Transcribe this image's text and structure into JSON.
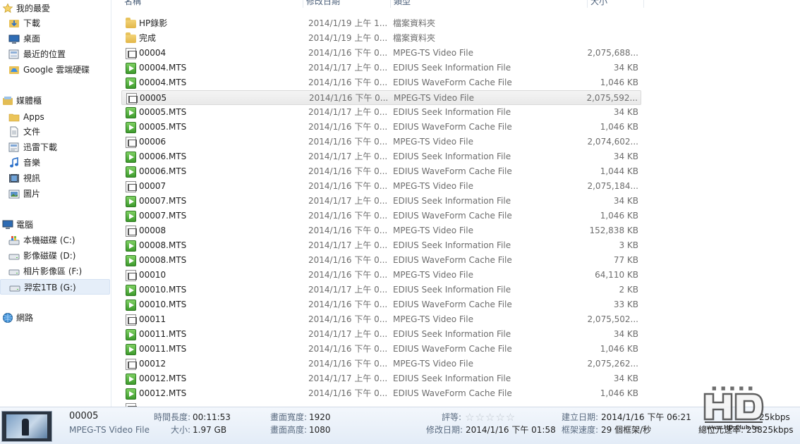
{
  "nav": {
    "favorites": {
      "label": "我的最愛",
      "icon": "star-icon"
    },
    "favorite_items": [
      {
        "label": "下載",
        "icon": "downloads-folder-icon"
      },
      {
        "label": "桌面",
        "icon": "desktop-icon"
      },
      {
        "label": "最近的位置",
        "icon": "recent-places-icon"
      },
      {
        "label": "Google 雲端硬碟",
        "icon": "google-drive-icon"
      }
    ],
    "libraries": {
      "label": "媒體櫃",
      "icon": "library-icon"
    },
    "library_items": [
      {
        "label": "Apps",
        "icon": "folder-icon"
      },
      {
        "label": "文件",
        "icon": "documents-icon"
      },
      {
        "label": "迅雷下載",
        "icon": "thunder-download-icon"
      },
      {
        "label": "音樂",
        "icon": "music-icon"
      },
      {
        "label": "視訊",
        "icon": "video-icon"
      },
      {
        "label": "圖片",
        "icon": "pictures-icon"
      }
    ],
    "computer": {
      "label": "電腦",
      "icon": "computer-icon"
    },
    "drives": [
      {
        "label": "本機磁碟 (C:)",
        "icon": "windows-drive-icon"
      },
      {
        "label": "影像磁碟 (D:)",
        "icon": "drive-icon"
      },
      {
        "label": "相片影像區 (F:)",
        "icon": "drive-icon"
      },
      {
        "label": "羿宏1TB (G:)",
        "icon": "drive-icon"
      }
    ],
    "network": {
      "label": "網路",
      "icon": "network-icon"
    }
  },
  "columns": {
    "name": "名稱",
    "date": "修改日期",
    "type": "類型",
    "size": "大小"
  },
  "files": [
    {
      "name": "HP錄影",
      "date": "2014/1/19 上午 1...",
      "type": "檔案資料夾",
      "size": "",
      "icon": "folder-icon"
    },
    {
      "name": "完成",
      "date": "2014/1/19 上午 0...",
      "type": "檔案資料夾",
      "size": "",
      "icon": "folder-icon"
    },
    {
      "name": "00004",
      "date": "2014/1/16 下午 0...",
      "type": "MPEG-TS Video File",
      "size": "2,075,688...",
      "icon": "video-file-icon"
    },
    {
      "name": "00004.MTS",
      "date": "2014/1/17 上午 0...",
      "type": "EDIUS Seek Information File",
      "size": "34 KB",
      "icon": "edius-file-icon"
    },
    {
      "name": "00004.MTS",
      "date": "2014/1/16 下午 0...",
      "type": "EDIUS WaveForm Cache File",
      "size": "1,046 KB",
      "icon": "edius-file-icon"
    },
    {
      "name": "00005",
      "date": "2014/1/16 下午 0...",
      "type": "MPEG-TS Video File",
      "size": "2,075,592...",
      "icon": "video-file-icon"
    },
    {
      "name": "00005.MTS",
      "date": "2014/1/17 上午 0...",
      "type": "EDIUS Seek Information File",
      "size": "34 KB",
      "icon": "edius-file-icon"
    },
    {
      "name": "00005.MTS",
      "date": "2014/1/16 下午 0...",
      "type": "EDIUS WaveForm Cache File",
      "size": "1,046 KB",
      "icon": "edius-file-icon"
    },
    {
      "name": "00006",
      "date": "2014/1/16 下午 0...",
      "type": "MPEG-TS Video File",
      "size": "2,074,602...",
      "icon": "video-file-icon"
    },
    {
      "name": "00006.MTS",
      "date": "2014/1/17 上午 0...",
      "type": "EDIUS Seek Information File",
      "size": "34 KB",
      "icon": "edius-file-icon"
    },
    {
      "name": "00006.MTS",
      "date": "2014/1/16 下午 0...",
      "type": "EDIUS WaveForm Cache File",
      "size": "1,044 KB",
      "icon": "edius-file-icon"
    },
    {
      "name": "00007",
      "date": "2014/1/16 下午 0...",
      "type": "MPEG-TS Video File",
      "size": "2,075,184...",
      "icon": "video-file-icon"
    },
    {
      "name": "00007.MTS",
      "date": "2014/1/17 上午 0...",
      "type": "EDIUS Seek Information File",
      "size": "34 KB",
      "icon": "edius-file-icon"
    },
    {
      "name": "00007.MTS",
      "date": "2014/1/16 下午 0...",
      "type": "EDIUS WaveForm Cache File",
      "size": "1,046 KB",
      "icon": "edius-file-icon"
    },
    {
      "name": "00008",
      "date": "2014/1/16 下午 0...",
      "type": "MPEG-TS Video File",
      "size": "152,838 KB",
      "icon": "video-file-icon"
    },
    {
      "name": "00008.MTS",
      "date": "2014/1/17 上午 0...",
      "type": "EDIUS Seek Information File",
      "size": "3 KB",
      "icon": "edius-file-icon"
    },
    {
      "name": "00008.MTS",
      "date": "2014/1/16 下午 0...",
      "type": "EDIUS WaveForm Cache File",
      "size": "77 KB",
      "icon": "edius-file-icon"
    },
    {
      "name": "00010",
      "date": "2014/1/16 下午 0...",
      "type": "MPEG-TS Video File",
      "size": "64,110 KB",
      "icon": "video-file-icon"
    },
    {
      "name": "00010.MTS",
      "date": "2014/1/17 上午 0...",
      "type": "EDIUS Seek Information File",
      "size": "2 KB",
      "icon": "edius-file-icon"
    },
    {
      "name": "00010.MTS",
      "date": "2014/1/16 下午 0...",
      "type": "EDIUS WaveForm Cache File",
      "size": "33 KB",
      "icon": "edius-file-icon"
    },
    {
      "name": "00011",
      "date": "2014/1/16 下午 0...",
      "type": "MPEG-TS Video File",
      "size": "2,075,502...",
      "icon": "video-file-icon"
    },
    {
      "name": "00011.MTS",
      "date": "2014/1/17 上午 0...",
      "type": "EDIUS Seek Information File",
      "size": "34 KB",
      "icon": "edius-file-icon"
    },
    {
      "name": "00011.MTS",
      "date": "2014/1/16 下午 0...",
      "type": "EDIUS WaveForm Cache File",
      "size": "1,046 KB",
      "icon": "edius-file-icon"
    },
    {
      "name": "00012",
      "date": "2014/1/16 下午 0...",
      "type": "MPEG-TS Video File",
      "size": "2,075,262...",
      "icon": "video-file-icon"
    },
    {
      "name": "00012.MTS",
      "date": "2014/1/17 上午 0...",
      "type": "EDIUS Seek Information File",
      "size": "34 KB",
      "icon": "edius-file-icon"
    },
    {
      "name": "00012.MTS",
      "date": "2014/1/16 下午 0...",
      "type": "EDIUS WaveForm Cache File",
      "size": "1,046 KB",
      "icon": "edius-file-icon"
    }
  ],
  "selected_file_index": 5,
  "details": {
    "name": "00005",
    "type": "MPEG-TS Video File",
    "duration_label": "時間長度:",
    "duration": "00:11:53",
    "size_label": "大小:",
    "size": "1.97 GB",
    "frame_width_label": "畫面寬度:",
    "frame_width": "1920",
    "frame_height_label": "畫面高度:",
    "frame_height": "1080",
    "rating_label": "評等:",
    "rating": 0,
    "rating_max": 5,
    "modified_label": "修改日期:",
    "modified": "2014/1/16 下午 01:58",
    "created_label": "建立日期:",
    "created": "2014/1/16 下午 06:21",
    "framerate_label": "框架速度:",
    "framerate": "29 個框架/秒",
    "data_rate_partial": "25kbps",
    "total_bitrate_partial": "總位元速率: 23825kbps"
  },
  "watermark": {
    "text": "www.HD.Club.tw"
  },
  "colors": {
    "selection": "#e5eef9",
    "details_bg": "#e3ecf7",
    "muted_text": "#6d6d6d"
  }
}
